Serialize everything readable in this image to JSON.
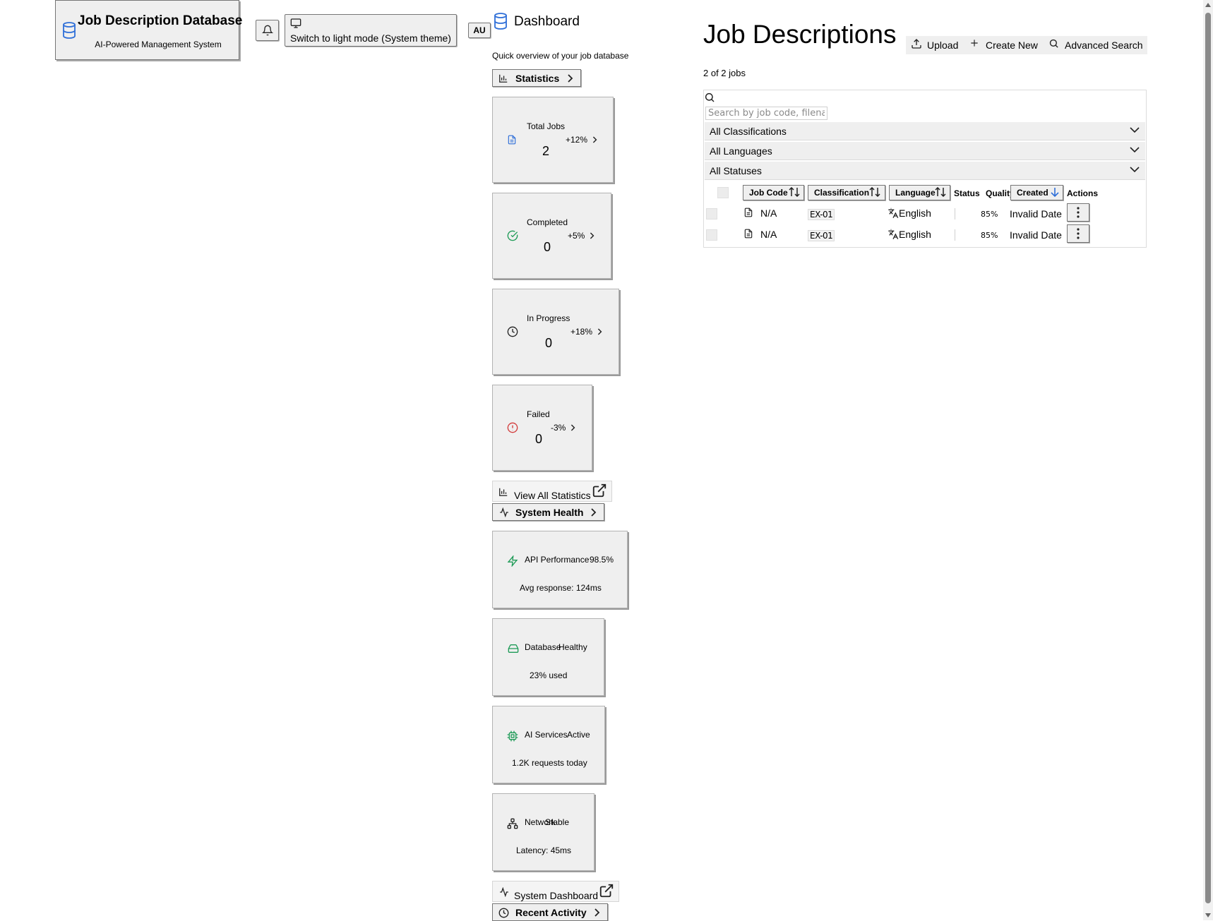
{
  "header": {
    "app_title": "Job Description Database",
    "app_subtitle": "AI-Powered Management System",
    "theme_toggle_label": "Switch to light mode (System theme)",
    "avatar_initials": "AU",
    "icons": [
      "database-icon",
      "bell-icon",
      "monitor-icon"
    ]
  },
  "dashboard": {
    "title": "Dashboard",
    "subtitle": "Quick overview of your job database",
    "statistics_label": "Statistics",
    "stats": [
      {
        "label": "Total Jobs",
        "value": "2",
        "change": "+12%",
        "icon": "file-text-icon",
        "color": "#2f6fd8"
      },
      {
        "label": "Completed",
        "value": "0",
        "change": "+5%",
        "icon": "check-circle-icon",
        "color": "#1e9b57"
      },
      {
        "label": "In Progress",
        "value": "0",
        "change": "+18%",
        "icon": "clock-icon",
        "color": "#222222"
      },
      {
        "label": "Failed",
        "value": "0",
        "change": "-3%",
        "icon": "alert-circle-icon",
        "color": "#d33b3b"
      }
    ],
    "view_all_statistics_label": "View All Statistics",
    "system_health_label": "System Health",
    "health": [
      {
        "name": "API Performance",
        "status": "98.5%",
        "detail": "Avg response: 124ms",
        "icon": "zap-icon",
        "color": "#1e9b57"
      },
      {
        "name": "Database",
        "status": "Healthy",
        "detail": "23% used",
        "icon": "hard-drive-icon",
        "color": "#1e9b57"
      },
      {
        "name": "AI Services",
        "status": "Active",
        "detail": "1.2K requests today",
        "icon": "cpu-icon",
        "color": "#1e9b57"
      },
      {
        "name": "Network",
        "status": "Stable",
        "detail": "Latency: 45ms",
        "icon": "network-icon",
        "color": "#222222"
      }
    ],
    "system_dashboard_label": "System Dashboard",
    "recent_activity_label": "Recent Activity"
  },
  "jobs": {
    "title": "Job Descriptions",
    "toolbar": {
      "upload": "Upload",
      "create_new": "Create New",
      "advanced_search": "Advanced Search"
    },
    "count_text": "2 of 2 jobs",
    "search_placeholder": "Search by job code, filename",
    "filters": [
      "All Classifications",
      "All Languages",
      "All Statuses"
    ],
    "columns": {
      "job_code": "Job Code",
      "classification": "Classification",
      "language": "Language",
      "status": "Status",
      "quality": "Quality",
      "created": "Created",
      "actions": "Actions"
    },
    "rows": [
      {
        "job_code": "N/A",
        "classification": "EX-01",
        "language": "English",
        "status": "",
        "quality": "85%",
        "created": "Invalid Date"
      },
      {
        "job_code": "N/A",
        "classification": "EX-01",
        "language": "English",
        "status": "",
        "quality": "85%",
        "created": "Invalid Date"
      }
    ]
  },
  "colors": {
    "accent": "#2f6fd8",
    "success": "#1e9b57",
    "danger": "#d33b3b"
  }
}
